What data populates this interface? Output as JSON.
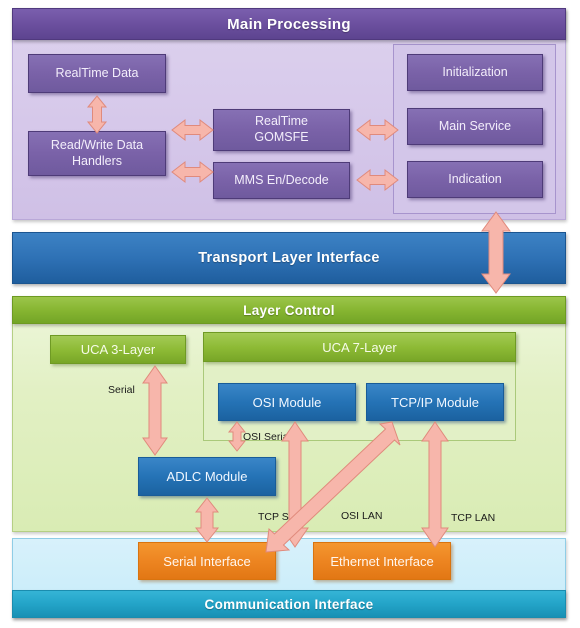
{
  "diagram": {
    "title": "Main Processing",
    "layers": {
      "main_processing": {
        "header": "Main Processing",
        "color": "#6b4f9e",
        "blocks": [
          {
            "id": "realtime-data",
            "label": "RealTime Data"
          },
          {
            "id": "read-write-handlers",
            "label": "Read/Write Data\nHandlers"
          },
          {
            "id": "realtime-gomsfe",
            "label": "RealTime\nGOMSFE"
          },
          {
            "id": "mms-en-decode",
            "label": "MMS En/Decode"
          },
          {
            "id": "initialization",
            "label": "Initialization"
          },
          {
            "id": "main-service",
            "label": "Main Service"
          },
          {
            "id": "indication",
            "label": "Indication"
          }
        ]
      },
      "transport_layer": {
        "header": "Transport Layer Interface",
        "color": "#2f72b6"
      },
      "layer_control": {
        "header": "Layer Control",
        "color": "#86b531",
        "blocks": [
          {
            "id": "uca-3-layer",
            "label": "UCA 3-Layer"
          },
          {
            "id": "uca-7-layer",
            "label": "UCA 7-Layer"
          },
          {
            "id": "osi-module",
            "label": "OSI Module"
          },
          {
            "id": "tcpip-module",
            "label": "TCP/IP Module"
          },
          {
            "id": "adlc-module",
            "label": "ADLC Module"
          }
        ]
      },
      "communication_interface": {
        "header": "Communication Interface",
        "color": "#23a4c8",
        "blocks": [
          {
            "id": "serial-interface",
            "label": "Serial Interface"
          },
          {
            "id": "ethernet-interface",
            "label": "Ethernet Interface"
          }
        ]
      }
    },
    "connection_labels": [
      {
        "id": "serial",
        "label": "Serial"
      },
      {
        "id": "osi-serial",
        "label": "OSI Serial"
      },
      {
        "id": "tcp-serial",
        "label": "TCP Serial"
      },
      {
        "id": "osi-lan",
        "label": "OSI LAN"
      },
      {
        "id": "tcp-lan",
        "label": "TCP LAN"
      }
    ],
    "colors": {
      "arrow_fill": "#f7b6ab",
      "arrow_stroke": "#e08a7c",
      "purple_block": "#7a62a8",
      "green_block": "#8ebb36",
      "blue_block": "#2573b6",
      "orange_block": "#ed8521"
    }
  }
}
